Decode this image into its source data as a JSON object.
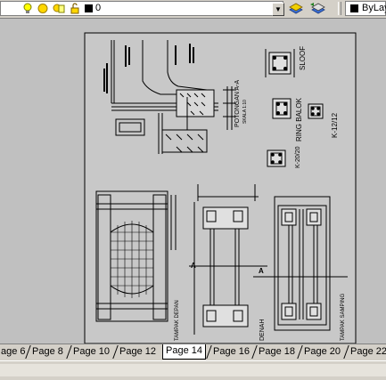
{
  "toolbar": {
    "layer_name": "0",
    "color_label": "ByLay"
  },
  "tabs": [
    {
      "label": "age 6"
    },
    {
      "label": "Page 8"
    },
    {
      "label": "Page 10"
    },
    {
      "label": "Page 12"
    },
    {
      "label": "Page 14",
      "active": true
    },
    {
      "label": "Page 16"
    },
    {
      "label": "Page 18"
    },
    {
      "label": "Page 20"
    },
    {
      "label": "Page 22"
    }
  ],
  "drawing": {
    "labels": {
      "sloof": "SLOOF",
      "ring_balok": "RING BALOK",
      "kolom": "K-12/12",
      "kolom2": "K-20/20",
      "potongan": "POTONGAN A-A",
      "skala": "SKALA 1:10",
      "denah": "DENAH",
      "tampak_depan": "TAMPAK DEPAN",
      "tampak_samping": "TAMPAK SAMPING",
      "a1": "A",
      "a2": "A"
    }
  },
  "colors": {
    "ui_face": "#d4d0c8",
    "canvas": "#c0c0c0",
    "paper": "#ffffff",
    "lines": "#000000",
    "bulb": "#ffff00",
    "sun": "#ffd700"
  }
}
